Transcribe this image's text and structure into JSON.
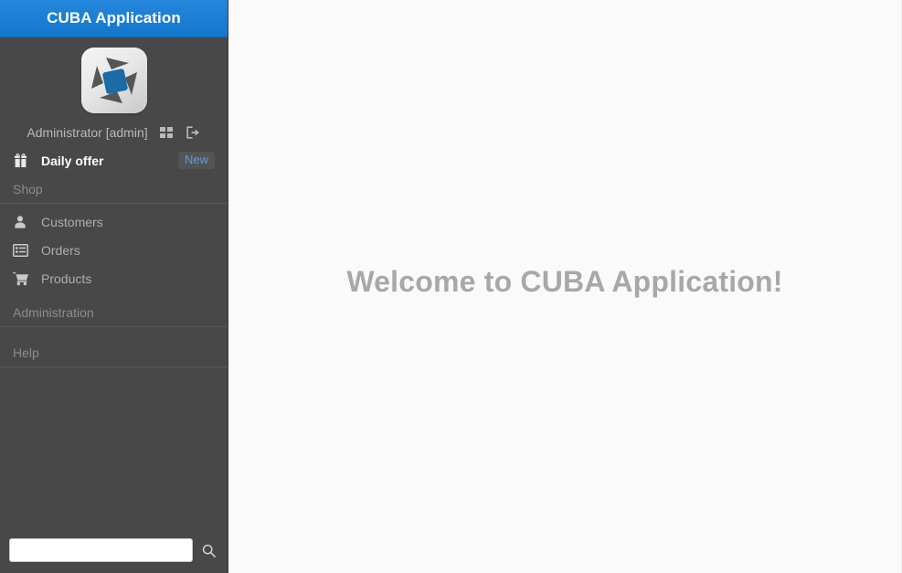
{
  "header": {
    "title": "CUBA Application",
    "background_color": "#1a7fd4"
  },
  "sidebar": {
    "background_color": "#484848",
    "user": {
      "name": "Administrator [admin]",
      "avatar_icon": "cuba-logo-icon",
      "actions": [
        {
          "icon": "grid-apps-icon",
          "name": "app-switcher"
        },
        {
          "icon": "sign-out-icon",
          "name": "logout"
        }
      ]
    },
    "menu": [
      {
        "type": "item",
        "label": "Daily offer",
        "icon": "gift-icon",
        "badge": "New",
        "highlight": true
      },
      {
        "type": "section",
        "label": "Shop",
        "items": [
          {
            "label": "Customers",
            "icon": "user-icon"
          },
          {
            "label": "Orders",
            "icon": "list-table-icon"
          },
          {
            "label": "Products",
            "icon": "shopping-cart-icon"
          }
        ]
      },
      {
        "type": "section",
        "label": "Administration",
        "items": []
      },
      {
        "type": "section",
        "label": "Help",
        "items": []
      }
    ],
    "search": {
      "value": "",
      "placeholder": "",
      "button_icon": "search-icon"
    }
  },
  "main": {
    "welcome_text": "Welcome to CUBA Application!",
    "background_color": "#fafafa",
    "text_color": "#a8a8a8"
  }
}
